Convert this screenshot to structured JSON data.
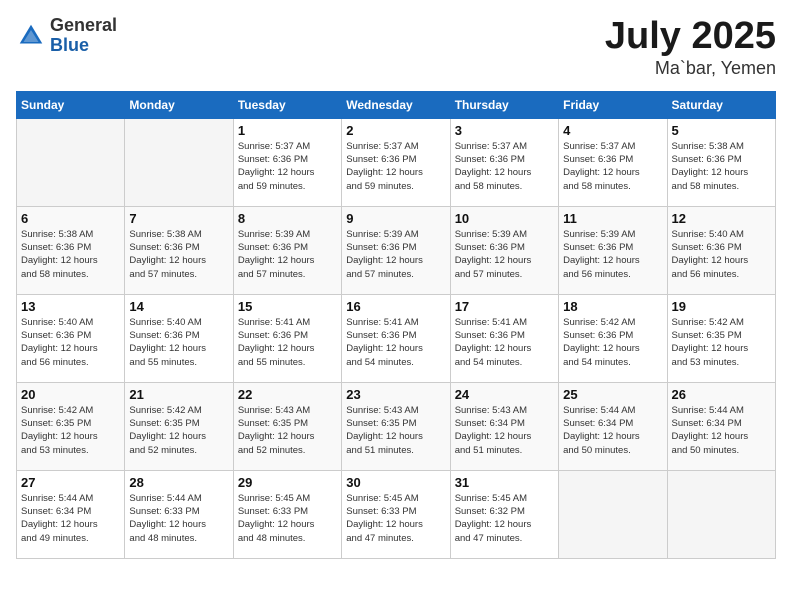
{
  "header": {
    "logo_general": "General",
    "logo_blue": "Blue",
    "month": "July 2025",
    "location": "Ma`bar, Yemen"
  },
  "days_of_week": [
    "Sunday",
    "Monday",
    "Tuesday",
    "Wednesday",
    "Thursday",
    "Friday",
    "Saturday"
  ],
  "weeks": [
    [
      {
        "num": "",
        "info": ""
      },
      {
        "num": "",
        "info": ""
      },
      {
        "num": "1",
        "info": "Sunrise: 5:37 AM\nSunset: 6:36 PM\nDaylight: 12 hours\nand 59 minutes."
      },
      {
        "num": "2",
        "info": "Sunrise: 5:37 AM\nSunset: 6:36 PM\nDaylight: 12 hours\nand 59 minutes."
      },
      {
        "num": "3",
        "info": "Sunrise: 5:37 AM\nSunset: 6:36 PM\nDaylight: 12 hours\nand 58 minutes."
      },
      {
        "num": "4",
        "info": "Sunrise: 5:37 AM\nSunset: 6:36 PM\nDaylight: 12 hours\nand 58 minutes."
      },
      {
        "num": "5",
        "info": "Sunrise: 5:38 AM\nSunset: 6:36 PM\nDaylight: 12 hours\nand 58 minutes."
      }
    ],
    [
      {
        "num": "6",
        "info": "Sunrise: 5:38 AM\nSunset: 6:36 PM\nDaylight: 12 hours\nand 58 minutes."
      },
      {
        "num": "7",
        "info": "Sunrise: 5:38 AM\nSunset: 6:36 PM\nDaylight: 12 hours\nand 57 minutes."
      },
      {
        "num": "8",
        "info": "Sunrise: 5:39 AM\nSunset: 6:36 PM\nDaylight: 12 hours\nand 57 minutes."
      },
      {
        "num": "9",
        "info": "Sunrise: 5:39 AM\nSunset: 6:36 PM\nDaylight: 12 hours\nand 57 minutes."
      },
      {
        "num": "10",
        "info": "Sunrise: 5:39 AM\nSunset: 6:36 PM\nDaylight: 12 hours\nand 57 minutes."
      },
      {
        "num": "11",
        "info": "Sunrise: 5:39 AM\nSunset: 6:36 PM\nDaylight: 12 hours\nand 56 minutes."
      },
      {
        "num": "12",
        "info": "Sunrise: 5:40 AM\nSunset: 6:36 PM\nDaylight: 12 hours\nand 56 minutes."
      }
    ],
    [
      {
        "num": "13",
        "info": "Sunrise: 5:40 AM\nSunset: 6:36 PM\nDaylight: 12 hours\nand 56 minutes."
      },
      {
        "num": "14",
        "info": "Sunrise: 5:40 AM\nSunset: 6:36 PM\nDaylight: 12 hours\nand 55 minutes."
      },
      {
        "num": "15",
        "info": "Sunrise: 5:41 AM\nSunset: 6:36 PM\nDaylight: 12 hours\nand 55 minutes."
      },
      {
        "num": "16",
        "info": "Sunrise: 5:41 AM\nSunset: 6:36 PM\nDaylight: 12 hours\nand 54 minutes."
      },
      {
        "num": "17",
        "info": "Sunrise: 5:41 AM\nSunset: 6:36 PM\nDaylight: 12 hours\nand 54 minutes."
      },
      {
        "num": "18",
        "info": "Sunrise: 5:42 AM\nSunset: 6:36 PM\nDaylight: 12 hours\nand 54 minutes."
      },
      {
        "num": "19",
        "info": "Sunrise: 5:42 AM\nSunset: 6:35 PM\nDaylight: 12 hours\nand 53 minutes."
      }
    ],
    [
      {
        "num": "20",
        "info": "Sunrise: 5:42 AM\nSunset: 6:35 PM\nDaylight: 12 hours\nand 53 minutes."
      },
      {
        "num": "21",
        "info": "Sunrise: 5:42 AM\nSunset: 6:35 PM\nDaylight: 12 hours\nand 52 minutes."
      },
      {
        "num": "22",
        "info": "Sunrise: 5:43 AM\nSunset: 6:35 PM\nDaylight: 12 hours\nand 52 minutes."
      },
      {
        "num": "23",
        "info": "Sunrise: 5:43 AM\nSunset: 6:35 PM\nDaylight: 12 hours\nand 51 minutes."
      },
      {
        "num": "24",
        "info": "Sunrise: 5:43 AM\nSunset: 6:34 PM\nDaylight: 12 hours\nand 51 minutes."
      },
      {
        "num": "25",
        "info": "Sunrise: 5:44 AM\nSunset: 6:34 PM\nDaylight: 12 hours\nand 50 minutes."
      },
      {
        "num": "26",
        "info": "Sunrise: 5:44 AM\nSunset: 6:34 PM\nDaylight: 12 hours\nand 50 minutes."
      }
    ],
    [
      {
        "num": "27",
        "info": "Sunrise: 5:44 AM\nSunset: 6:34 PM\nDaylight: 12 hours\nand 49 minutes."
      },
      {
        "num": "28",
        "info": "Sunrise: 5:44 AM\nSunset: 6:33 PM\nDaylight: 12 hours\nand 48 minutes."
      },
      {
        "num": "29",
        "info": "Sunrise: 5:45 AM\nSunset: 6:33 PM\nDaylight: 12 hours\nand 48 minutes."
      },
      {
        "num": "30",
        "info": "Sunrise: 5:45 AM\nSunset: 6:33 PM\nDaylight: 12 hours\nand 47 minutes."
      },
      {
        "num": "31",
        "info": "Sunrise: 5:45 AM\nSunset: 6:32 PM\nDaylight: 12 hours\nand 47 minutes."
      },
      {
        "num": "",
        "info": ""
      },
      {
        "num": "",
        "info": ""
      }
    ]
  ]
}
